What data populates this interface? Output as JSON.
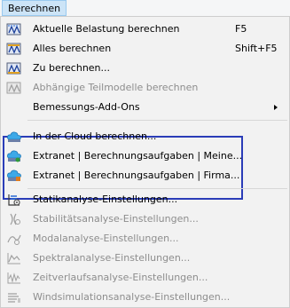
{
  "menubar": {
    "title": "Berechnen"
  },
  "colors": {
    "highlight_border": "#2b3db8",
    "menubar_active": "#cce4f7",
    "disabled_text": "#8d8d8d"
  },
  "menu": {
    "items": [
      {
        "label": "Aktuelle Belastung berechnen",
        "shortcut": "F5",
        "icon": "calculate-load-icon",
        "enabled": true
      },
      {
        "label": "Alles berechnen",
        "shortcut": "Shift+F5",
        "icon": "calculate-all-icon",
        "enabled": true
      },
      {
        "label": "Zu berechnen...",
        "icon": "to-calculate-icon",
        "enabled": true
      },
      {
        "label": "Abhängige Teilmodelle berechnen",
        "icon": "dependent-submodels-icon",
        "enabled": false
      },
      {
        "label": "Bemessungs-Add-Ons",
        "icon": "",
        "enabled": true,
        "submenu": true
      },
      {
        "label": "In der Cloud berechnen...",
        "icon": "cloud-calculate-icon",
        "enabled": true
      },
      {
        "label": "Extranet | Berechnungsaufgaben | Meine...",
        "icon": "extranet-my-tasks-icon",
        "enabled": true
      },
      {
        "label": "Extranet | Berechnungsaufgaben | Firma...",
        "icon": "extranet-company-tasks-icon",
        "enabled": true
      },
      {
        "label": "Statikanalyse-Einstellungen...",
        "icon": "static-analysis-settings-icon",
        "enabled": true
      },
      {
        "label": "Stabilitätsanalyse-Einstellungen...",
        "icon": "stability-analysis-settings-icon",
        "enabled": false
      },
      {
        "label": "Modalanalyse-Einstellungen...",
        "icon": "modal-analysis-settings-icon",
        "enabled": false
      },
      {
        "label": "Spektralanalyse-Einstellungen...",
        "icon": "spectral-analysis-settings-icon",
        "enabled": false
      },
      {
        "label": "Zeitverlaufsanalyse-Einstellungen...",
        "icon": "time-history-settings-icon",
        "enabled": false
      },
      {
        "label": "Windsimulationsanalyse-Einstellungen...",
        "icon": "wind-simulation-settings-icon",
        "enabled": false
      }
    ]
  }
}
